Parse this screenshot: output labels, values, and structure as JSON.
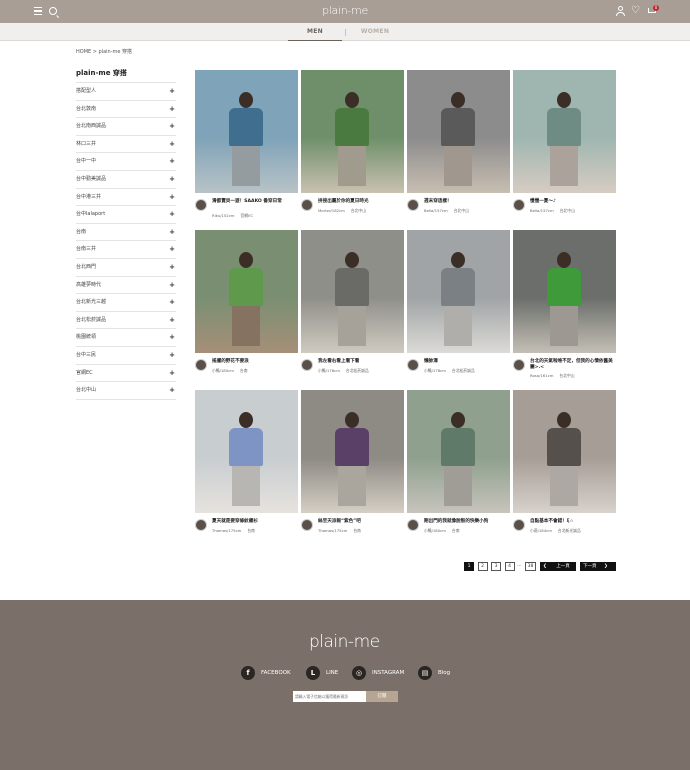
{
  "header": {
    "logo": "plain-me",
    "cart_count": "0"
  },
  "subnav": {
    "tabs": [
      "MEN",
      "WOMEN"
    ],
    "active": "MEN"
  },
  "breadcrumb": "HOME  >  plain-me 穿搭",
  "sidebar": {
    "title": "plain-me 穿搭",
    "items": [
      "搭配型人",
      "台北敦南",
      "台北南西誠品",
      "林口三井",
      "台中一中",
      "台中勤美誠品",
      "台中港三井",
      "台中lalaport",
      "台南",
      "台南三井",
      "台北西門",
      "高雄夢時代",
      "台北新光三越",
      "台北松菸誠品",
      "桃園統領",
      "台中三民",
      "官網EC",
      "台北中山"
    ]
  },
  "posts": [
    {
      "title": "滑都賣貝一遊！SAAKO 番穿日常",
      "name": "Riku/152cm",
      "store": "官網EC",
      "colors": [
        "#7fa3b8",
        "#3f6e8e",
        "#b9c3c7"
      ]
    },
    {
      "title": "拼接出屬於你的夏日時光",
      "name": "Morise/182cm",
      "store": "台北中山",
      "colors": [
        "#6f8f6a",
        "#4a7a3f",
        "#c9c2b0"
      ]
    },
    {
      "title": "週末穿這樣！",
      "name": "Bella/157cm",
      "store": "台北中山",
      "colors": [
        "#8c8c8c",
        "#5a5a5a",
        "#c8beb2"
      ]
    },
    {
      "title": "慢慢一夏～♪",
      "name": "Bella/157cm",
      "store": "台北中山",
      "colors": [
        "#9fb6b0",
        "#6f8c84",
        "#d6ccc2"
      ]
    },
    {
      "title": "搖擺的野花不要浪",
      "name": "小鴨/180cm",
      "store": "台南",
      "colors": [
        "#7a8f72",
        "#5f9a4c",
        "#a68f78"
      ]
    },
    {
      "title": "我左看右看上看下看",
      "name": "小鴨/178cm",
      "store": "台北松菸誠品",
      "colors": [
        "#8f8f8a",
        "#6a6a66",
        "#cfcac0"
      ]
    },
    {
      "title": "懶帥澤",
      "name": "小鴨/178cm",
      "store": "台北松菸誠品",
      "colors": [
        "#a0a4a6",
        "#7b8085",
        "#dcdad6"
      ]
    },
    {
      "title": "台北的天氣啦唯不定，但我的心情依舊美麗>.<",
      "name": "Rosa/161cm",
      "store": "台北中山",
      "colors": [
        "#6b6e6a",
        "#3f9a3a",
        "#c4bfb6"
      ]
    },
    {
      "title": "夏天就是要穿條紋襯衫",
      "name": "Thomas/175cm",
      "store": "台南",
      "colors": [
        "#c8cdd0",
        "#7d94c4",
        "#e6e3de"
      ]
    },
    {
      "title": "絲至天派報“紫色”吧",
      "name": "Thomas/175cm",
      "store": "台南",
      "colors": [
        "#8e8a84",
        "#5a3f66",
        "#d5cfc4"
      ]
    },
    {
      "title": "剛出門的我就像脫殼的快樂小狗",
      "name": "小鴨/180cm",
      "store": "台南",
      "colors": [
        "#8fa08e",
        "#5f7a68",
        "#c7c4bc"
      ]
    },
    {
      "title": "自點基本不會錯！ξ☆",
      "name": "小燕/164cm",
      "store": "台北新光誠品",
      "colors": [
        "#a79d97",
        "#55504c",
        "#d8d2cc"
      ]
    }
  ],
  "pagination": {
    "pages": [
      "1",
      "2",
      "3",
      "4"
    ],
    "ellipsis": "...",
    "last": "38",
    "prev": "上一頁",
    "next": "下一頁"
  },
  "footer": {
    "logo": "plain-me",
    "social": [
      {
        "icon": "facebook-icon",
        "glyph": "f",
        "label": "FACEBOOK"
      },
      {
        "icon": "line-icon",
        "glyph": "L",
        "label": "LINE"
      },
      {
        "icon": "instagram-icon",
        "glyph": "◎",
        "label": "INSTAGRAM"
      },
      {
        "icon": "blog-icon",
        "glyph": "▤",
        "label": "Blog"
      }
    ],
    "subscribe_placeholder": "請輸入電子信箱以獲得最新資訊",
    "subscribe_button": "訂閱"
  },
  "colors": {
    "header_bg": "#a89e95",
    "footer_bg": "#7a7069",
    "accent": "#b5a592"
  }
}
